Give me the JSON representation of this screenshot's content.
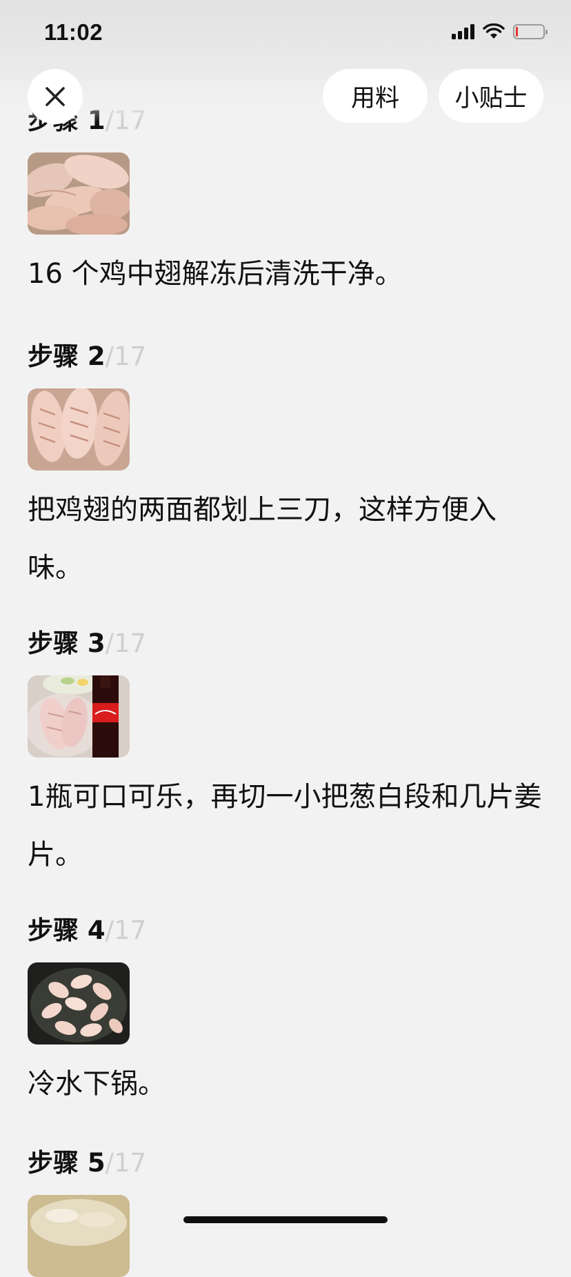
{
  "status_bar": {
    "time": "11:02"
  },
  "header": {
    "ingredients_label": "用料",
    "tips_label": "小贴士"
  },
  "steps": [
    {
      "title": "步骤 1",
      "total": "/17",
      "text": "16 个鸡中翅解冻后清洗干净。"
    },
    {
      "title": "步骤 2",
      "total": "/17",
      "text": "把鸡翅的两面都划上三刀，这样方便入味。"
    },
    {
      "title": "步骤 3",
      "total": "/17",
      "text": "1瓶可口可乐，再切一小把葱白段和几片姜片。"
    },
    {
      "title": "步骤 4",
      "total": "/17",
      "text": "冷水下锅。"
    },
    {
      "title": "步骤 5",
      "total": "/17",
      "text": ""
    }
  ]
}
